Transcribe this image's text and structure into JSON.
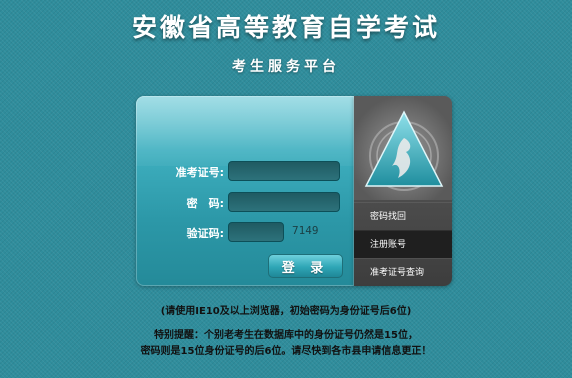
{
  "header": {
    "title": "安徽省高等教育自学考试",
    "subtitle": "考生服务平台"
  },
  "login": {
    "exam_number_label": "准考证号:",
    "exam_number_value": "",
    "password_label": "密　码:",
    "password_value": "",
    "captcha_label": "验证码:",
    "captcha_value": "",
    "captcha_code": "7149",
    "submit_label": "登 录"
  },
  "side_menu": {
    "logo_icon": "triangle-flame-logo",
    "items": [
      {
        "label": "密码找回"
      },
      {
        "label": "注册账号",
        "active": true
      },
      {
        "label": "准考证号查询"
      }
    ]
  },
  "notices": {
    "browser_hint": "(请使用IE10及以上浏览器，初始密码为身份证号后6位)",
    "special_line1": "特别提醒：个别老考生在数据库中的身份证号仍然是15位，",
    "special_line2": "密码则是15位身份证号的后6位。请尽快到各市县申请信息更正！"
  },
  "colors": {
    "background": "#2f8d9c",
    "panel_accent": "#3fb0c0",
    "side_panel": "#4c4c4c",
    "menu_active": "#1f1f1f"
  }
}
